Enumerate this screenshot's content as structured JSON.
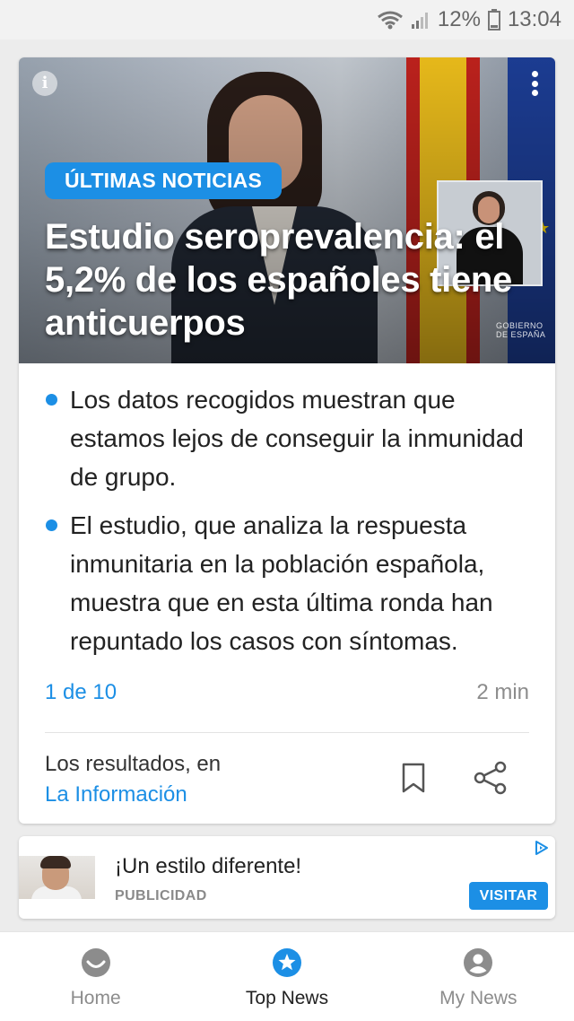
{
  "status_bar": {
    "battery": "12%",
    "time": "13:04",
    "icons": [
      "wifi-icon",
      "signal-icon",
      "battery-icon"
    ]
  },
  "article": {
    "badge": "ÚLTIMAS NOTICIAS",
    "headline": "Estudio seroprevalencia: el 5,2% de los españoles tiene anticuerpos",
    "image_caption": "GOBIERNO DE ESPAÑA",
    "bullets": [
      "Los datos recogidos muestran que estamos lejos de conseguir la inmunidad de grupo.",
      "El estudio, que analiza la respuesta inmunitaria en la población española, muestra que en esta última ronda han repuntado los casos con síntomas."
    ],
    "pager": "1 de 10",
    "read_time": "2 min",
    "source_label": "Los resultados, en",
    "source_name": "La Información"
  },
  "ad": {
    "title": "¡Un estilo diferente!",
    "label": "PUBLICIDAD",
    "button": "VISITAR"
  },
  "bottom_nav": {
    "items": [
      {
        "label": "Home",
        "icon": "smile-icon"
      },
      {
        "label": "Top News",
        "icon": "star-icon"
      },
      {
        "label": "My News",
        "icon": "user-icon"
      }
    ],
    "active": "Top News"
  },
  "colors": {
    "accent": "#1c8fe5",
    "muted": "#8c8c8c",
    "background": "#ececec"
  }
}
